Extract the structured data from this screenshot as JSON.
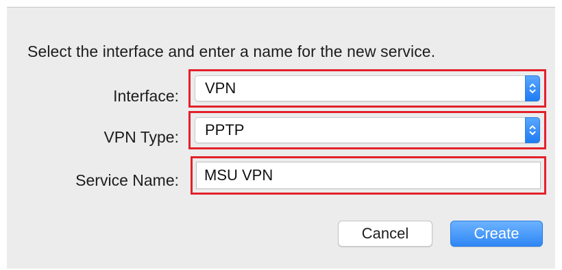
{
  "dialog": {
    "instruction": "Select the interface and enter a name for the new service."
  },
  "form": {
    "interface": {
      "label": "Interface:",
      "value": "VPN"
    },
    "vpn_type": {
      "label": "VPN Type:",
      "value": "PPTP"
    },
    "service_name": {
      "label": "Service Name:",
      "value": "MSU VPN"
    }
  },
  "buttons": {
    "cancel_label": "Cancel",
    "create_label": "Create"
  },
  "colors": {
    "highlight": "#e3202a",
    "accent": "#2f86f5",
    "background": "#ececec"
  },
  "icons": {
    "popup_arrows": "chevron-up-down-icon"
  }
}
